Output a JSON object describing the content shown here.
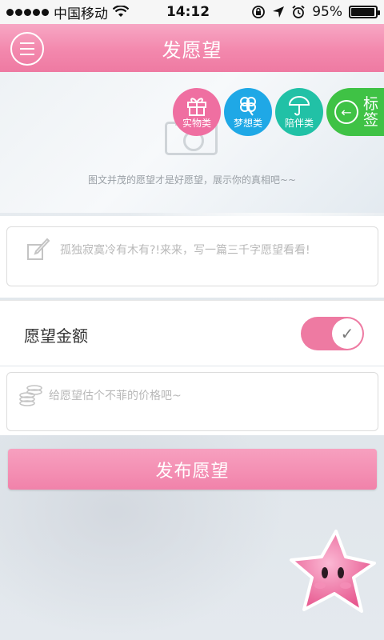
{
  "status_bar": {
    "carrier": "中国移动",
    "time": "14:12",
    "battery": "95%",
    "battery_level": 0.95
  },
  "header": {
    "title": "发愿望"
  },
  "photo": {
    "hint": "图文并茂的愿望才是好愿望，展示你的真相吧~~"
  },
  "categories": [
    {
      "label": "实物类",
      "icon": "gift-icon",
      "color": "#ef6fa1"
    },
    {
      "label": "梦想类",
      "icon": "clover-icon",
      "color": "#1fa8e6"
    },
    {
      "label": "陪伴类",
      "icon": "umbrella-icon",
      "color": "#21c1a6"
    }
  ],
  "tag_button": {
    "label": "标签",
    "color": "#3fc245"
  },
  "wish_text": {
    "placeholder": "孤独寂寞冷有木有?!来来，写一篇三千字愿望看看!"
  },
  "amount": {
    "label": "愿望金额",
    "toggle_on": true
  },
  "price": {
    "placeholder": "给愿望估个不菲的价格吧~"
  },
  "publish": {
    "label": "发布愿望"
  },
  "colors": {
    "accent": "#ee7aa2",
    "header": "#f388ad"
  }
}
